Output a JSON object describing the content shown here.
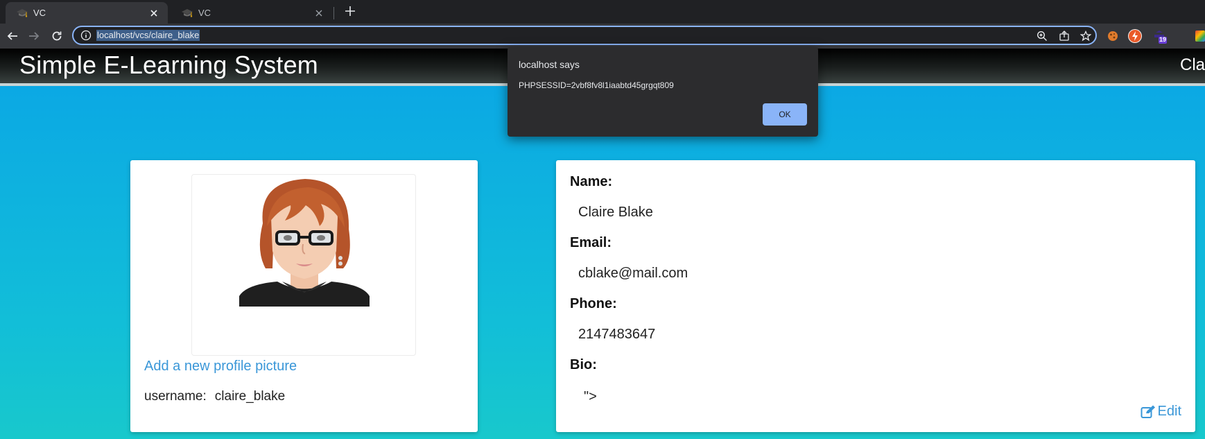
{
  "browser": {
    "tabs": [
      {
        "title": "VC",
        "active": true
      },
      {
        "title": "VC",
        "active": false
      }
    ],
    "url": "localhost/vcs/claire_blake",
    "extension_badge": "19"
  },
  "site": {
    "title": "Simple E-Learning System",
    "user_partial": "Cla"
  },
  "profile": {
    "add_picture_link": "Add a new profile picture",
    "username_label": "username:",
    "username": "claire_blake"
  },
  "details": {
    "name_label": "Name:",
    "name": "Claire Blake",
    "email_label": "Email:",
    "email": "cblake@mail.com",
    "phone_label": "Phone:",
    "phone": "2147483647",
    "bio_label": "Bio:",
    "bio": "\">",
    "edit_label": "Edit"
  },
  "alert": {
    "title": "localhost says",
    "message": "PHPSESSID=2vbf8fv8l1iaabtd45grgqt809",
    "ok_label": "OK"
  },
  "colors": {
    "accent_link": "#3a97d8",
    "dialog_button": "#8ab4f8",
    "page_bg_top": "#0aa5e6",
    "page_bg_bottom": "#18c8cc"
  }
}
